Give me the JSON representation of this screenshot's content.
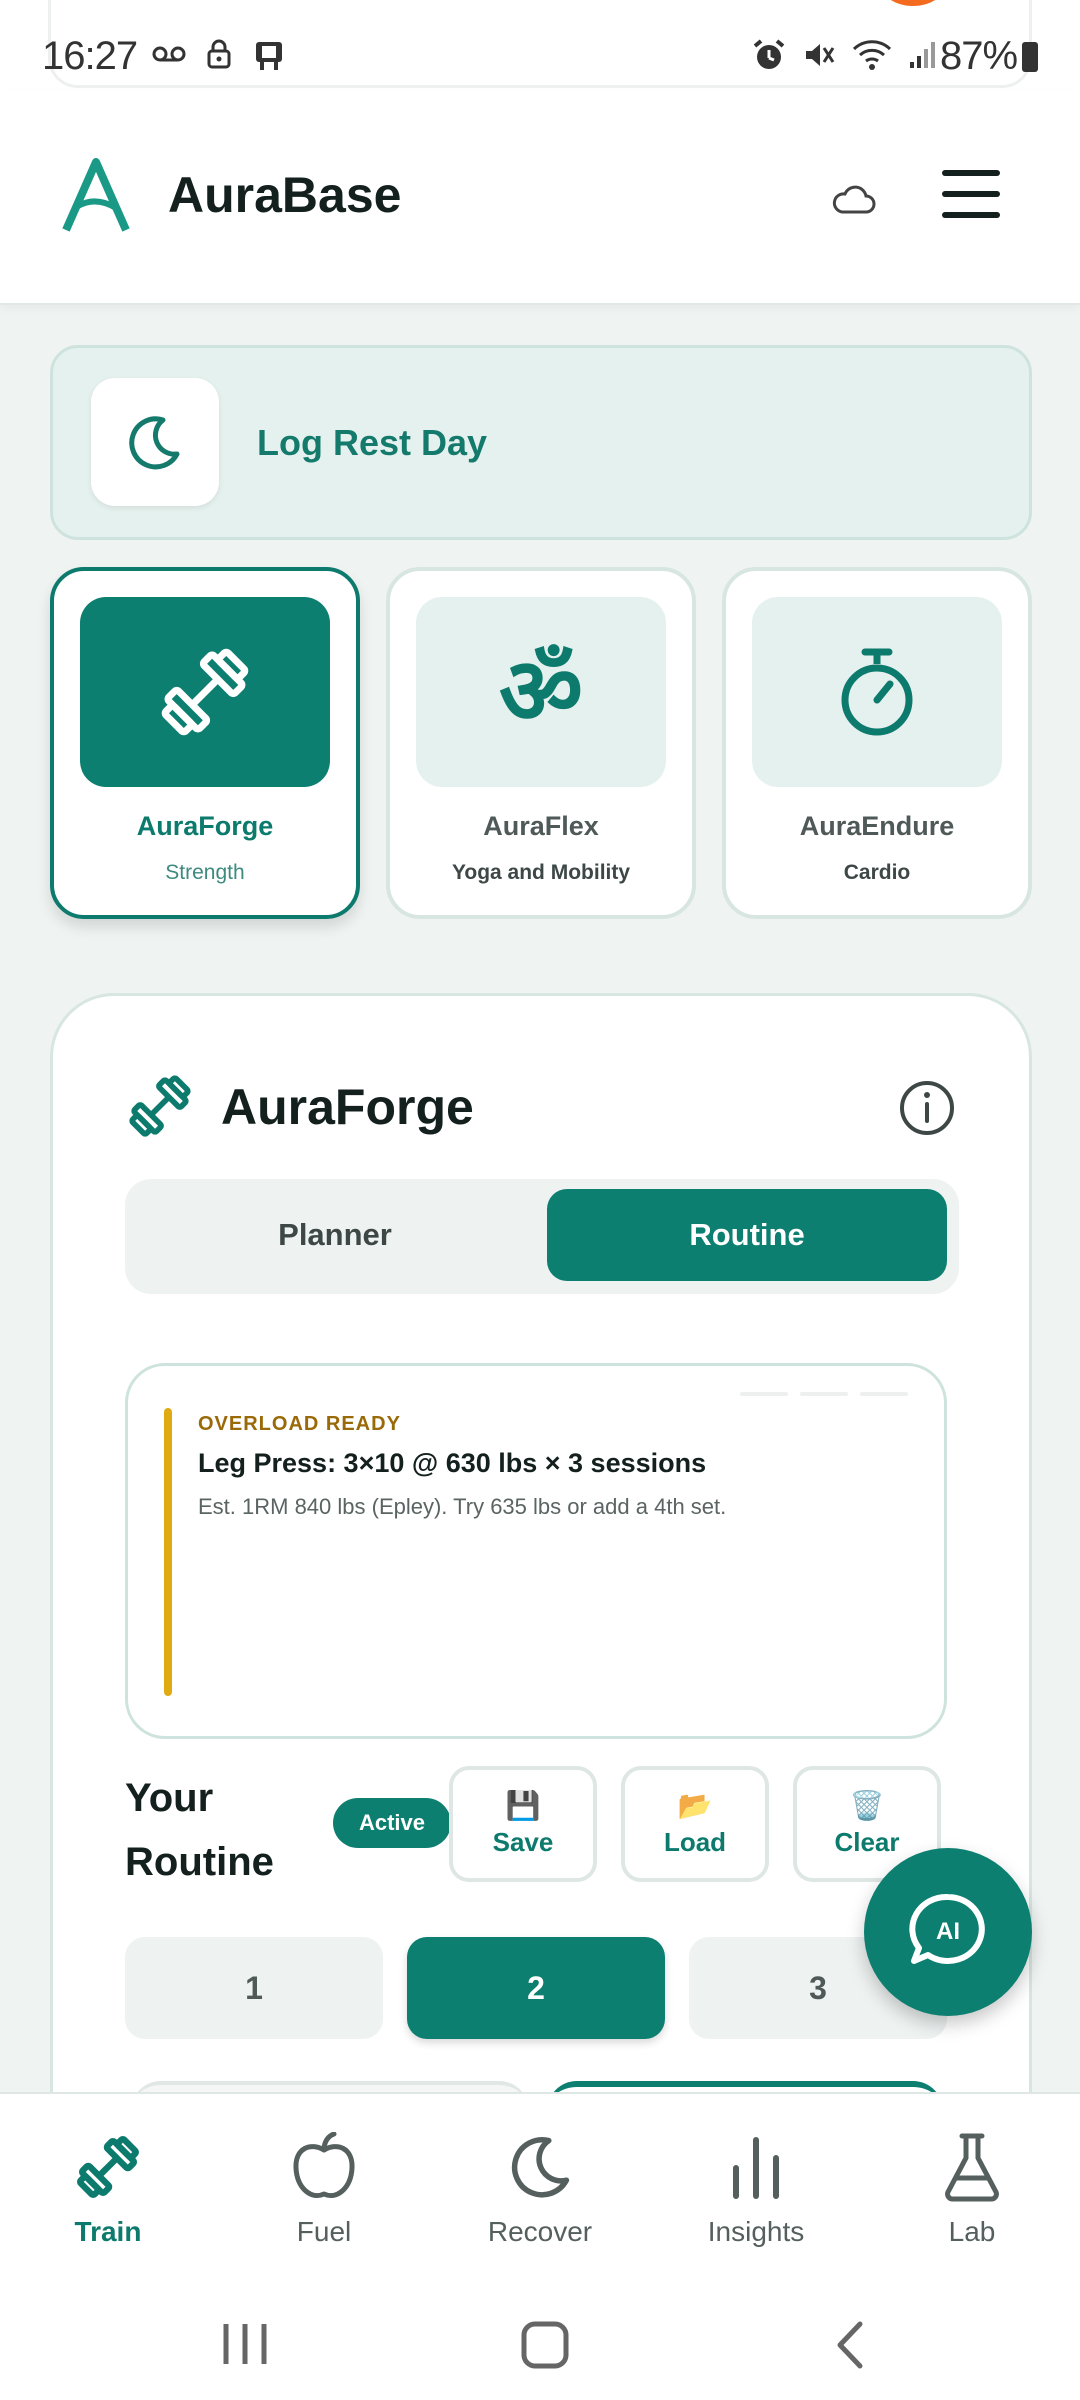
{
  "status_bar": {
    "time": "16:27",
    "battery": "87%"
  },
  "header": {
    "brand": "AuraBase"
  },
  "rest_day": {
    "label": "Log Rest Day"
  },
  "disciplines": [
    {
      "name": "AuraForge",
      "subtitle": "Strength",
      "selected": true
    },
    {
      "name": "AuraFlex",
      "subtitle": "Yoga and Mobility",
      "selected": false
    },
    {
      "name": "AuraEndure",
      "subtitle": "Cardio",
      "selected": false
    }
  ],
  "main": {
    "title": "AuraForge",
    "tabs": [
      {
        "label": "Planner"
      },
      {
        "label": "Routine",
        "active": true
      }
    ],
    "tip": {
      "tag": "OVERLOAD READY",
      "title": "Leg Press: 3×10 @ 630 lbs × 3 sessions",
      "text": "Est. 1RM 840 lbs (Epley). Try 635 lbs or add a 4th set."
    },
    "routine": {
      "title": "Your Routine",
      "badge": "Active",
      "actions": [
        {
          "label": "Save",
          "icon": "💾"
        },
        {
          "label": "Load",
          "icon": "📂"
        },
        {
          "label": "Clear",
          "icon": "🗑️"
        }
      ],
      "days": [
        "1",
        "2",
        "3"
      ],
      "selected_day": "2"
    }
  },
  "fab": {
    "label": "AI"
  },
  "bottom_nav": [
    {
      "label": "Train",
      "icon": "dumbbell-icon",
      "selected": true
    },
    {
      "label": "Fuel",
      "icon": "apple-icon"
    },
    {
      "label": "Recover",
      "icon": "moon-icon"
    },
    {
      "label": "Insights",
      "icon": "bar-chart-icon"
    },
    {
      "label": "Lab",
      "icon": "flask-icon"
    }
  ],
  "colors": {
    "accent": "#0c7f70",
    "warning": "#e0ab12",
    "background": "#eff3f1"
  }
}
